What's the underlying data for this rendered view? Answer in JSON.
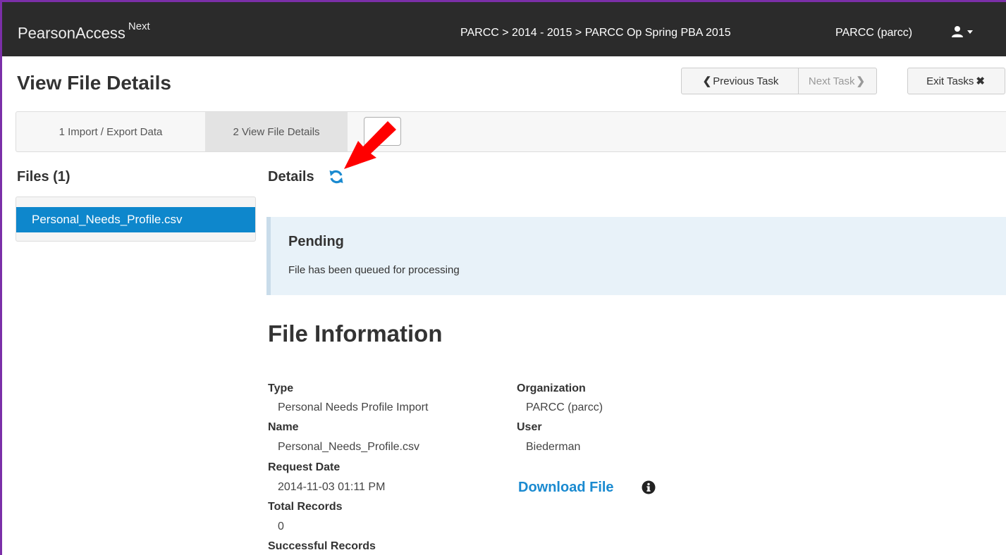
{
  "header": {
    "brand": "PearsonAccess",
    "brand_sup": "Next",
    "breadcrumb": "PARCC > 2014 - 2015 > PARCC Op Spring PBA 2015",
    "org": "PARCC (parcc)",
    "user_icon": "user-icon"
  },
  "page": {
    "title": "View File Details",
    "prev_task": "Previous Task",
    "next_task": "Next Task",
    "exit_tasks": "Exit Tasks"
  },
  "steps": [
    {
      "label": "1 Import / Export Data"
    },
    {
      "label": "2 View File Details"
    }
  ],
  "files": {
    "title": "Files (1)",
    "items": [
      {
        "name": "Personal_Needs_Profile.csv"
      }
    ]
  },
  "details": {
    "title": "Details",
    "refresh_icon": "refresh-icon",
    "status_title": "Pending",
    "status_message": "File has been queued for processing"
  },
  "file_info": {
    "title": "File Information",
    "type_label": "Type",
    "type_value": "Personal Needs Profile Import",
    "name_label": "Name",
    "name_value": "Personal_Needs_Profile.csv",
    "request_date_label": "Request Date",
    "request_date_value": "2014-11-03 01:11 PM",
    "total_records_label": "Total Records",
    "total_records_value": "0",
    "successful_records_label": "Successful Records",
    "organization_label": "Organization",
    "organization_value": "PARCC (parcc)",
    "user_label": "User",
    "user_value": "Biederman",
    "download_label": "Download File"
  },
  "colors": {
    "navbar": "#2b2b2b",
    "accent": "#0e87cc",
    "annotation_arrow": "#ff0000",
    "frame": "#7b2fa8"
  }
}
